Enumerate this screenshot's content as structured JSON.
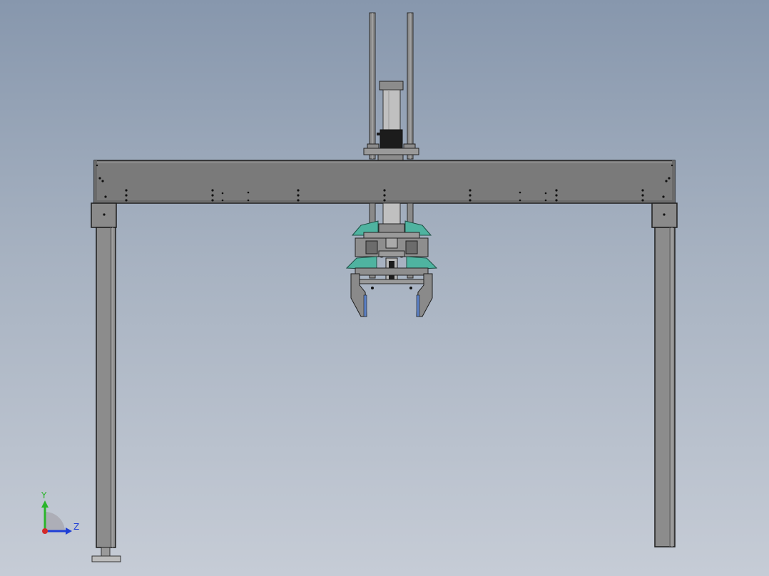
{
  "view": {
    "background_top": "#8797ad",
    "background_bottom": "#c6ccd6"
  },
  "model": {
    "frame_color": "#7a7a7a",
    "accent_color": "#4fb3a0",
    "pad_color": "#5a7fc4"
  },
  "triad": {
    "y_axis_label": "Y",
    "z_axis_label": "Z",
    "y_color": "#2ab52a",
    "z_color": "#1f3fd6",
    "x_color": "#d42a2a"
  }
}
